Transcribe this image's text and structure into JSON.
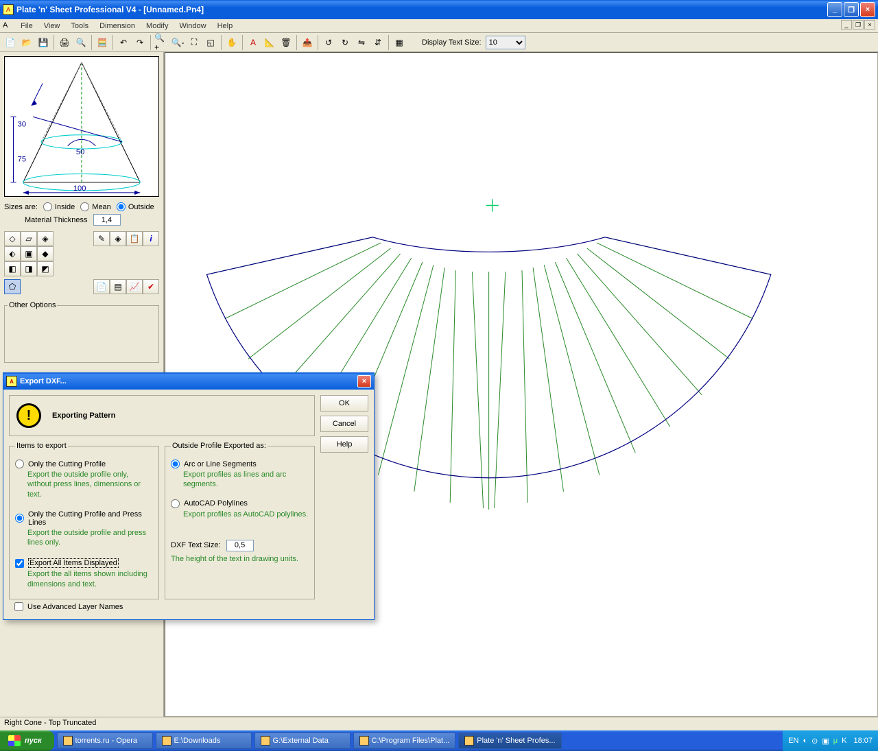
{
  "window": {
    "title": "Plate 'n' Sheet Professional V4 - [Unnamed.Pn4]"
  },
  "menu": [
    "File",
    "View",
    "Tools",
    "Dimension",
    "Modify",
    "Window",
    "Help"
  ],
  "toolbar": {
    "display_text_label": "Display Text Size:",
    "display_text_value": "10"
  },
  "sidepanel": {
    "dims": {
      "d30": "30",
      "d75": "75",
      "d50": "50",
      "d100": "100"
    },
    "sizes_label": "Sizes are:",
    "size_options": [
      "Inside",
      "Mean",
      "Outside"
    ],
    "thickness_label": "Material Thickness",
    "thickness_value": "1,4",
    "other_options_label": "Other Options"
  },
  "dialog": {
    "title": "Export DXF...",
    "heading": "Exporting Pattern",
    "buttons": {
      "ok": "OK",
      "cancel": "Cancel",
      "help": "Help"
    },
    "items_legend": "Items to export",
    "items": [
      {
        "label": "Only the Cutting Profile",
        "desc": "Export the outside profile only, without press lines, dimensions or text.",
        "type": "radio",
        "checked": false
      },
      {
        "label": "Only the Cutting Profile and Press Lines",
        "desc": "Export the outside profile and press lines only.",
        "type": "radio",
        "checked": true
      },
      {
        "label": "Export All Items Displayed",
        "desc": "Export the all items shown including dimensions and text.",
        "type": "check",
        "checked": true
      }
    ],
    "profile_legend": "Outside Profile Exported as:",
    "profiles": [
      {
        "label": "Arc or Line Segments",
        "desc": "Export profiles as lines and arc segments.",
        "checked": true
      },
      {
        "label": "AutoCAD Polylines",
        "desc": "Export profiles as AutoCAD polylines.",
        "checked": false
      }
    ],
    "dxf_text_size_label": "DXF Text Size:",
    "dxf_text_size_value": "0,5",
    "dxf_text_height_desc": "The height of the text in drawing units.",
    "advanced_label": "Use Advanced Layer Names"
  },
  "statusbar": "Right Cone - Top Truncated",
  "taskbar": {
    "start": "пуск",
    "tasks": [
      "torrents.ru - Opera",
      "E:\\Downloads",
      "G:\\External Data",
      "C:\\Program Files\\Plat...",
      "Plate 'n' Sheet Profes..."
    ],
    "lang": "EN",
    "clock": "18:07"
  }
}
